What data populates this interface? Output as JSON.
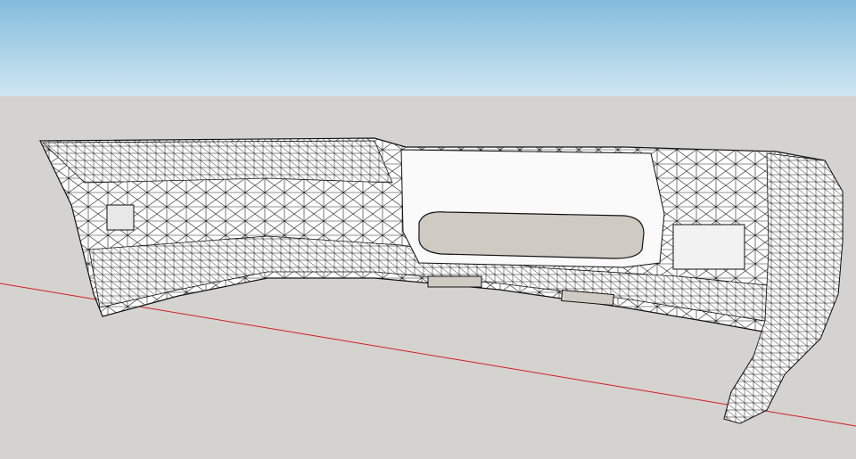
{
  "viewport": {
    "sky_top_color": "#84bcdc",
    "sky_bottom_color": "#cfe6f1",
    "ground_color": "#d5d3cf",
    "axis_color": "#d02020",
    "model_fill": "#ffffff",
    "edge_color": "#111111",
    "recess_color": "#cfcbc3",
    "model_name": "front-bumper-wireframe-mesh"
  }
}
